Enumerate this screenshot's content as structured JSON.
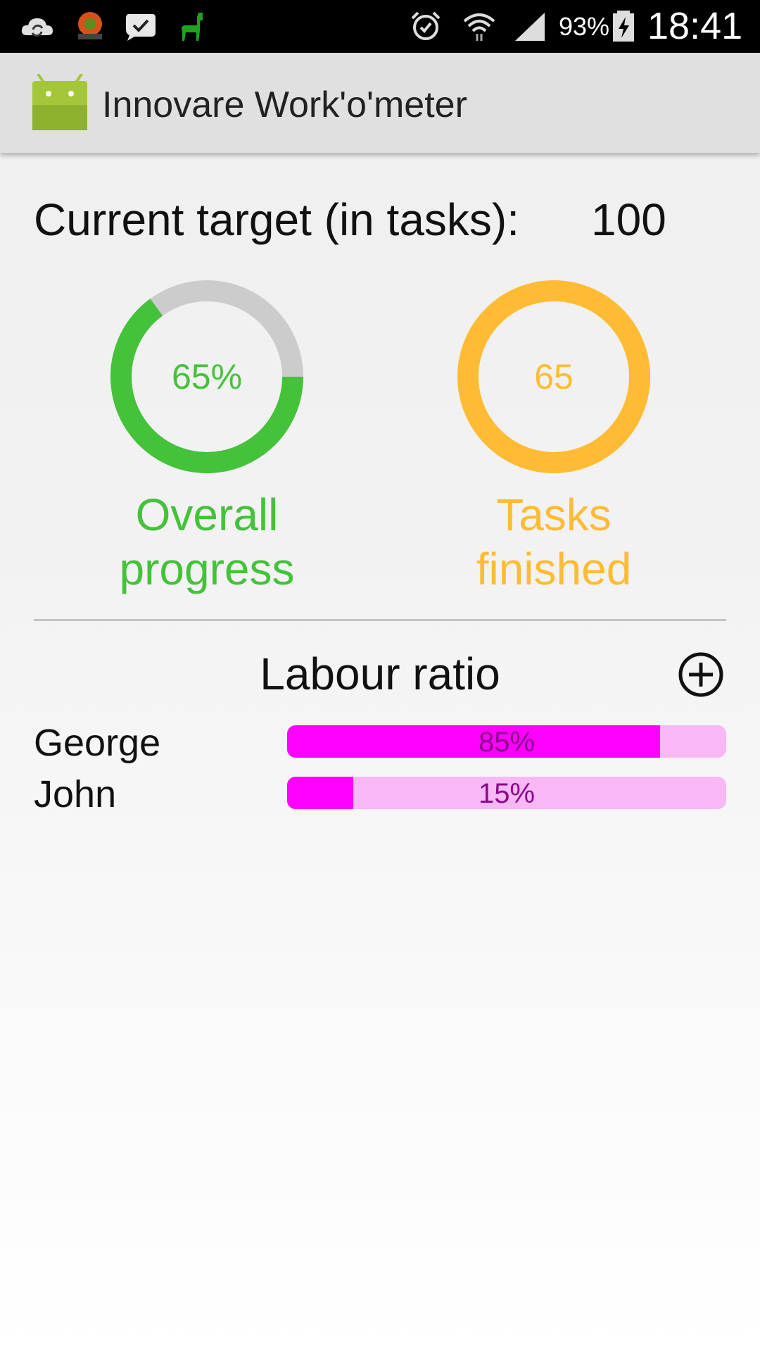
{
  "status_bar": {
    "battery_percent": "93%",
    "time": "18:41",
    "icons": [
      "cloud-sync-icon",
      "ubuntu-app-icon",
      "checkmark-bubble-icon",
      "green-llama-icon",
      "alarm-icon",
      "wifi-icon",
      "signal-icon",
      "battery-charging-icon"
    ]
  },
  "app_bar": {
    "title": "Innovare Work'o'meter",
    "logo_icon": "android-logo-icon"
  },
  "target": {
    "label": "Current target (in tasks):",
    "value": "100"
  },
  "progress": {
    "percent_text": "65%",
    "fraction": 0.65,
    "caption_line1": "Overall",
    "caption_line2": "progress",
    "color": "#44c23a",
    "track_color": "#cccccc"
  },
  "tasks": {
    "count_text": "65",
    "fraction": 1.0,
    "caption_line1": "Tasks",
    "caption_line2": "finished",
    "color": "#ffbb33"
  },
  "labour": {
    "title": "Labour ratio",
    "add_icon": "add-circle-icon",
    "rows": [
      {
        "name": "George",
        "percent_text": "85%",
        "fraction": 0.85
      },
      {
        "name": "John",
        "percent_text": "15%",
        "fraction": 0.15
      }
    ],
    "fill_color": "#ff00ff",
    "track_color": "#f7b8f5"
  }
}
